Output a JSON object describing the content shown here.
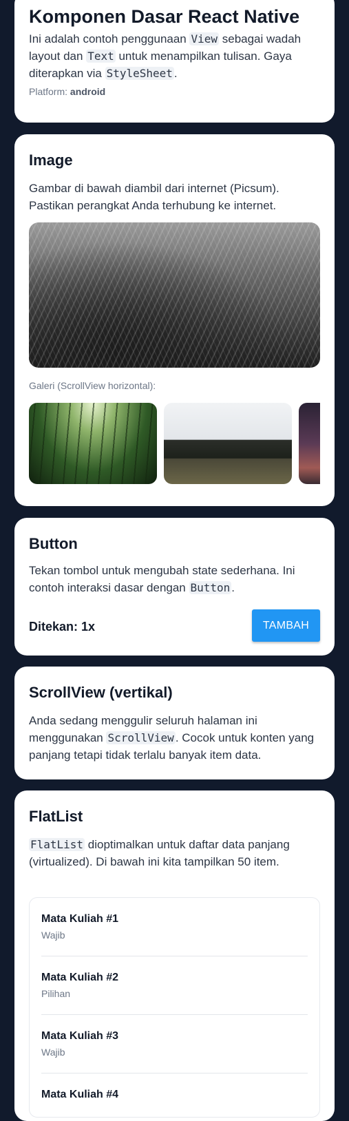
{
  "basics": {
    "title": "Komponen Dasar React Native",
    "desc_1": "Ini adalah contoh penggunaan ",
    "code_view": "View",
    "desc_2": " sebagai wadah layout dan ",
    "code_text": "Text",
    "desc_3": " untuk menampilkan tulisan. Gaya diterapkan via ",
    "code_stylesheet": "StyleSheet",
    "desc_4": ".",
    "platform_label": "Platform: ",
    "platform_value": "android"
  },
  "image": {
    "title": "Image",
    "desc": "Gambar di bawah diambil dari internet (Picsum). Pastikan perangkat Anda terhubung ke internet.",
    "gallery_label": "Galeri (ScrollView horizontal):"
  },
  "button": {
    "title": "Button",
    "desc_1": "Tekan tombol untuk mengubah state sederhana. Ini contoh interaksi dasar dengan ",
    "code_button": "Button",
    "desc_2": ".",
    "count_text": "Ditekan: 1x",
    "button_label": "TAMBAH",
    "accent": "#2196f3"
  },
  "scrollview": {
    "title": "ScrollView (vertikal)",
    "desc_1": "Anda sedang menggulir seluruh halaman ini menggunakan ",
    "code_scrollview": "ScrollView",
    "desc_2": ". Cocok untuk konten yang panjang tetapi tidak terlalu banyak item data."
  },
  "flatlist": {
    "title": "FlatList",
    "code_flatlist": "FlatList",
    "desc": " dioptimalkan untuk daftar data panjang (virtualized). Di bawah ini kita tampilkan 50 item.",
    "items": [
      {
        "title": "Mata Kuliah #1",
        "subtitle": "Wajib"
      },
      {
        "title": "Mata Kuliah #2",
        "subtitle": "Pilihan"
      },
      {
        "title": "Mata Kuliah #3",
        "subtitle": "Wajib"
      },
      {
        "title": "Mata Kuliah #4",
        "subtitle": ""
      }
    ]
  },
  "colors": {
    "background": "#111a2c",
    "card": "#ffffff",
    "accent": "#2196f3"
  }
}
